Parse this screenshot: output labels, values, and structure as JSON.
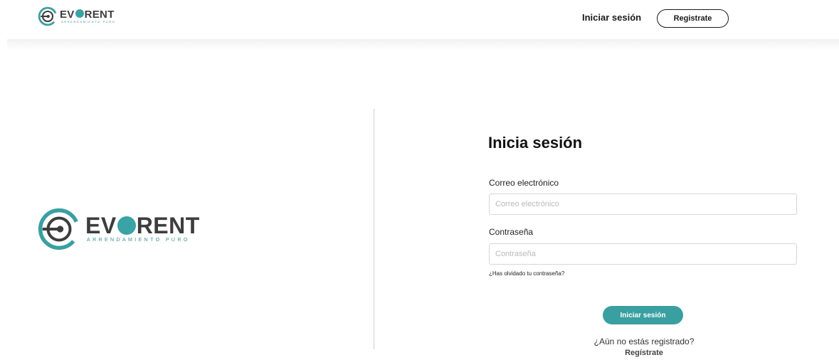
{
  "brand": {
    "name_prefix": "EV",
    "name_suffix": "RENT",
    "tagline": "ARRENDAMIENTO PURO",
    "accent_color": "#3a9fa1",
    "text_color": "#3d3d3d"
  },
  "header": {
    "login_label": "Iniciar sesión",
    "register_label": "Registrate"
  },
  "form": {
    "title": "Inicia sesión",
    "email_label": "Correo electrónico",
    "email_placeholder": "Correo electrónico",
    "email_value": "",
    "password_label": "Contraseña",
    "password_placeholder": "Contraseña",
    "password_value": "",
    "forgot_label": "¿Has olvidado tu contraseña?",
    "submit_label": "Iniciar sesión",
    "not_registered_text": "¿Aún no estás registrado?",
    "register_link_label": "Regístrate"
  }
}
